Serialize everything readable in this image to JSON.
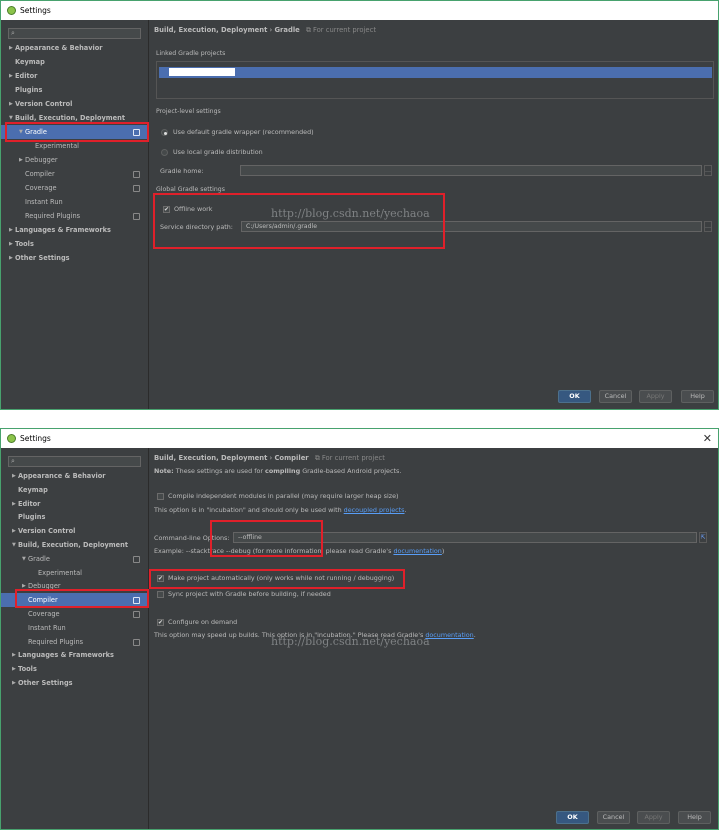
{
  "window1": {
    "title": "Settings",
    "search": {
      "placeholder": ""
    },
    "tree": [
      {
        "label": "Appearance & Behavior",
        "arrow": "▶"
      },
      {
        "label": "Keymap",
        "arrow": ""
      },
      {
        "label": "Editor",
        "arrow": "▶"
      },
      {
        "label": "Plugins",
        "arrow": ""
      },
      {
        "label": "Version Control",
        "arrow": "▶"
      },
      {
        "label": "Build, Execution, Deployment",
        "arrow": "▼"
      },
      {
        "label": "Gradle",
        "arrow": "▼"
      },
      {
        "label": "Experimental",
        "arrow": ""
      },
      {
        "label": "Debugger",
        "arrow": "▶"
      },
      {
        "label": "Compiler",
        "arrow": ""
      },
      {
        "label": "Coverage",
        "arrow": ""
      },
      {
        "label": "Instant Run",
        "arrow": ""
      },
      {
        "label": "Required Plugins",
        "arrow": ""
      },
      {
        "label": "Languages & Frameworks",
        "arrow": "▶"
      },
      {
        "label": "Tools",
        "arrow": "▶"
      },
      {
        "label": "Other Settings",
        "arrow": "▶"
      }
    ],
    "breadcrumb": {
      "path": "Build, Execution, Deployment",
      "sep": "›",
      "current": "Gradle",
      "scope": "For current project"
    },
    "linked_projects_label": "Linked Gradle projects",
    "project_level_label": "Project-level settings",
    "radio_default_wrapper": "Use default gradle wrapper (recommended)",
    "radio_local_distribution": "Use local gradle distribution",
    "gradle_home_label": "Gradle home:",
    "gradle_home_value": "",
    "global_label": "Global Gradle settings",
    "offline_work_label": "Offline work",
    "offline_work_checked": true,
    "service_dir_label": "Service directory path:",
    "service_dir_value": "C:/Users/admin/.gradle",
    "buttons": {
      "ok": "OK",
      "cancel": "Cancel",
      "apply": "Apply",
      "help": "Help"
    },
    "watermark": "http://blog.csdn.net/yechaoa"
  },
  "window2": {
    "title": "Settings",
    "search": {
      "placeholder": ""
    },
    "tree": [
      {
        "label": "Appearance & Behavior",
        "arrow": "▶"
      },
      {
        "label": "Keymap",
        "arrow": ""
      },
      {
        "label": "Editor",
        "arrow": "▶"
      },
      {
        "label": "Plugins",
        "arrow": ""
      },
      {
        "label": "Version Control",
        "arrow": "▶"
      },
      {
        "label": "Build, Execution, Deployment",
        "arrow": "▼"
      },
      {
        "label": "Gradle",
        "arrow": "▼"
      },
      {
        "label": "Experimental",
        "arrow": ""
      },
      {
        "label": "Debugger",
        "arrow": "▶"
      },
      {
        "label": "Compiler",
        "arrow": ""
      },
      {
        "label": "Coverage",
        "arrow": ""
      },
      {
        "label": "Instant Run",
        "arrow": ""
      },
      {
        "label": "Required Plugins",
        "arrow": ""
      },
      {
        "label": "Languages & Frameworks",
        "arrow": "▶"
      },
      {
        "label": "Tools",
        "arrow": "▶"
      },
      {
        "label": "Other Settings",
        "arrow": "▶"
      }
    ],
    "breadcrumb": {
      "path": "Build, Execution, Deployment",
      "sep": "›",
      "current": "Compiler",
      "scope": "For current project"
    },
    "note_prefix": "Note:",
    "note_mid": "These settings are used for",
    "note_strong": "compiling",
    "note_suffix": "Gradle-based Android projects.",
    "compile_parallel_label": "Compile independent modules in parallel (may require larger heap size)",
    "incubation_text": "This option is in \"incubation\" and should only be used with",
    "incubation_link": "decoupled projects",
    "cmdline_label": "Command-line Options:",
    "cmdline_value": "--offline",
    "example_text": "Example: --stacktrace --debug (for more information, please read Gradle's",
    "example_link": "documentation",
    "example_end": ")",
    "make_auto_label": "Make project automatically (only works while not running / debugging)",
    "make_auto_checked": true,
    "sync_label": "Sync project with Gradle before building, if needed",
    "sync_checked": false,
    "configure_label": "Configure on demand",
    "configure_checked": true,
    "speedup_text": "This option may speed up builds. This option is in \"incubation.\" Please read Gradle's",
    "speedup_link": "documentation",
    "buttons": {
      "ok": "OK",
      "cancel": "Cancel",
      "apply": "Apply",
      "help": "Help"
    },
    "watermark": "http://blog.csdn.net/yechaoa"
  },
  "colors": {
    "background": "#3c3f41",
    "selection": "#4b6eaf",
    "link": "#589df6",
    "highlight_box": "#e0202a",
    "window_border": "#48a26e"
  }
}
